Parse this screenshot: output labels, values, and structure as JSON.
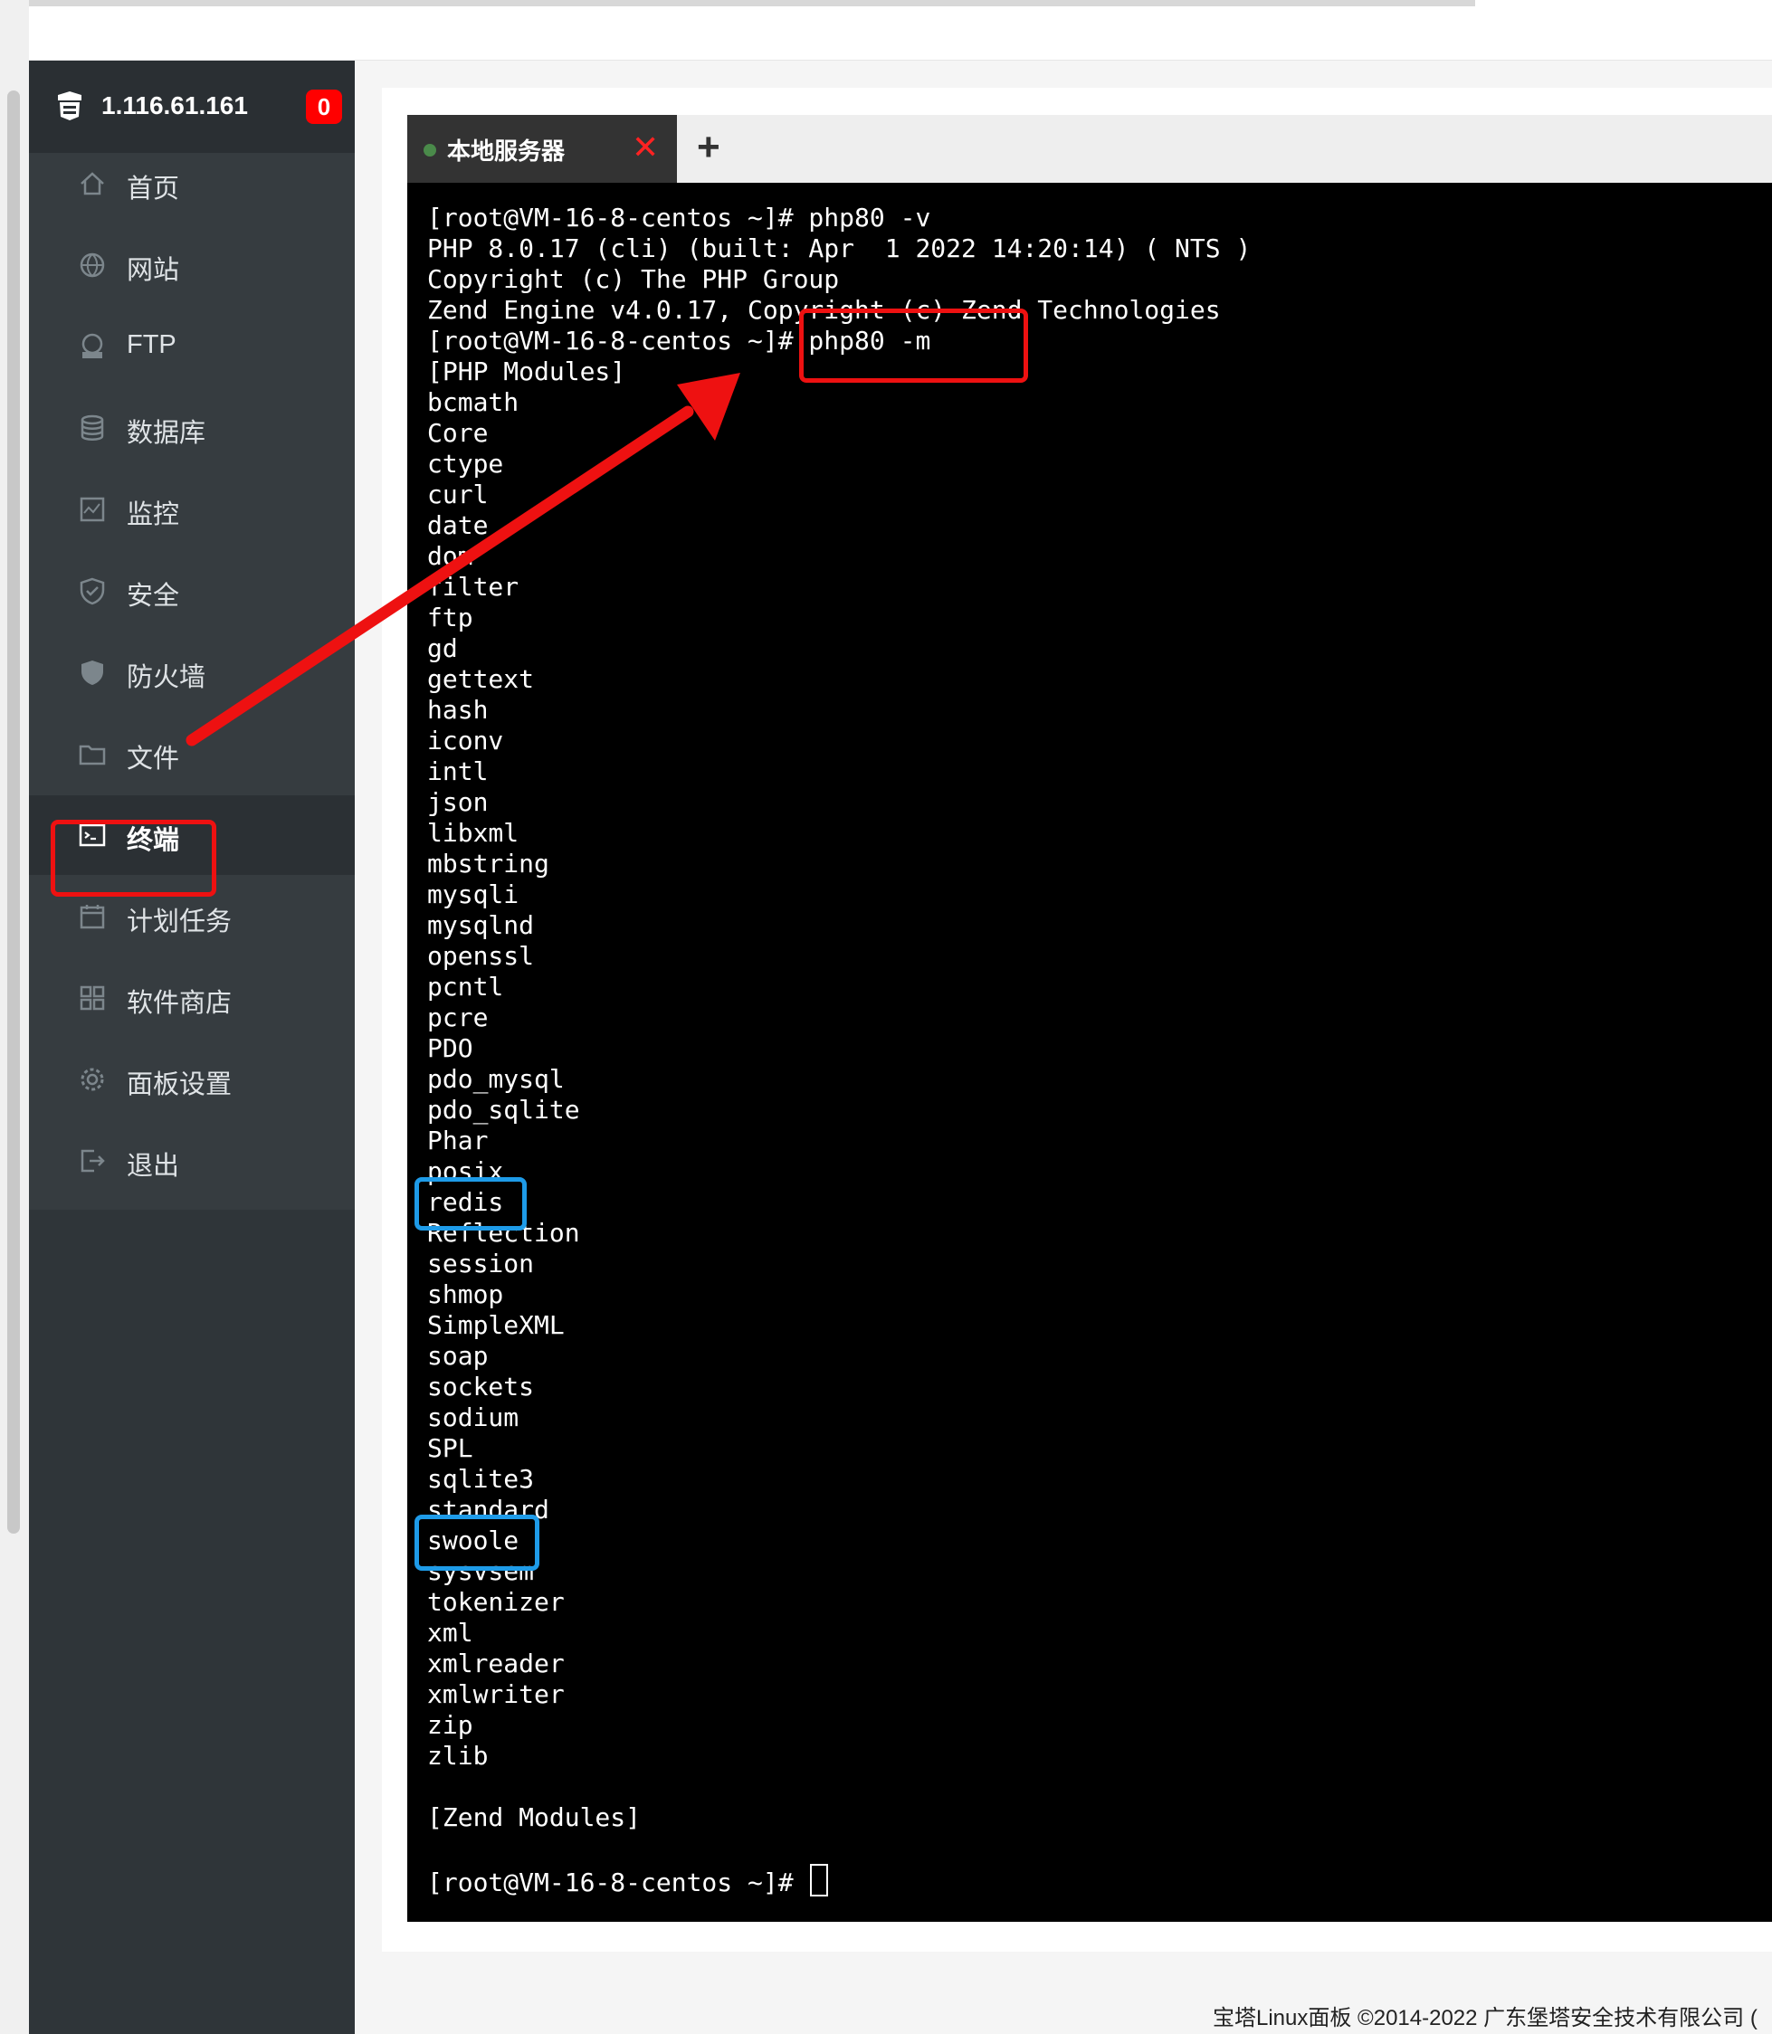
{
  "header": {
    "server_ip": "1.116.61.161",
    "notification_count": "0"
  },
  "sidebar": {
    "items": [
      {
        "label": "首页",
        "icon": "home-icon"
      },
      {
        "label": "网站",
        "icon": "globe-icon"
      },
      {
        "label": "FTP",
        "icon": "ftp-icon"
      },
      {
        "label": "数据库",
        "icon": "database-icon"
      },
      {
        "label": "监控",
        "icon": "monitor-icon"
      },
      {
        "label": "安全",
        "icon": "shield-check-icon"
      },
      {
        "label": "防火墙",
        "icon": "firewall-icon"
      },
      {
        "label": "文件",
        "icon": "folder-icon"
      },
      {
        "label": "终端",
        "icon": "terminal-icon",
        "active": true
      },
      {
        "label": "计划任务",
        "icon": "calendar-icon"
      },
      {
        "label": "软件商店",
        "icon": "apps-icon"
      },
      {
        "label": "面板设置",
        "icon": "gear-icon"
      },
      {
        "label": "退出",
        "icon": "logout-icon"
      }
    ]
  },
  "tabs": [
    {
      "label": "本地服务器",
      "status_color": "#4a8a4a"
    }
  ],
  "terminal": {
    "lines": [
      "[root@VM-16-8-centos ~]# php80 -v",
      "PHP 8.0.17 (cli) (built: Apr  1 2022 14:20:14) ( NTS )",
      "Copyright (c) The PHP Group",
      "Zend Engine v4.0.17, Copyright (c) Zend Technologies",
      "[root@VM-16-8-centos ~]# php80 -m",
      "[PHP Modules]",
      "bcmath",
      "Core",
      "ctype",
      "curl",
      "date",
      "dom",
      "filter",
      "ftp",
      "gd",
      "gettext",
      "hash",
      "iconv",
      "intl",
      "json",
      "libxml",
      "mbstring",
      "mysqli",
      "mysqlnd",
      "openssl",
      "pcntl",
      "pcre",
      "PDO",
      "pdo_mysql",
      "pdo_sqlite",
      "Phar",
      "posix",
      "redis",
      "Reflection",
      "session",
      "shmop",
      "SimpleXML",
      "soap",
      "sockets",
      "sodium",
      "SPL",
      "sqlite3",
      "standard",
      "swoole",
      "sysvsem",
      "tokenizer",
      "xml",
      "xmlreader",
      "xmlwriter",
      "zip",
      "zlib",
      "",
      "[Zend Modules]",
      "",
      "[root@VM-16-8-centos ~]# "
    ]
  },
  "footer": {
    "text": "宝塔Linux面板 ©2014-2022 广东堡塔安全技术有限公司 ("
  },
  "colors": {
    "sidebar_bg": "#2f3539",
    "annotation_red": "#ee1111",
    "annotation_blue": "#1e9be8",
    "badge_red": "#ff0000"
  }
}
